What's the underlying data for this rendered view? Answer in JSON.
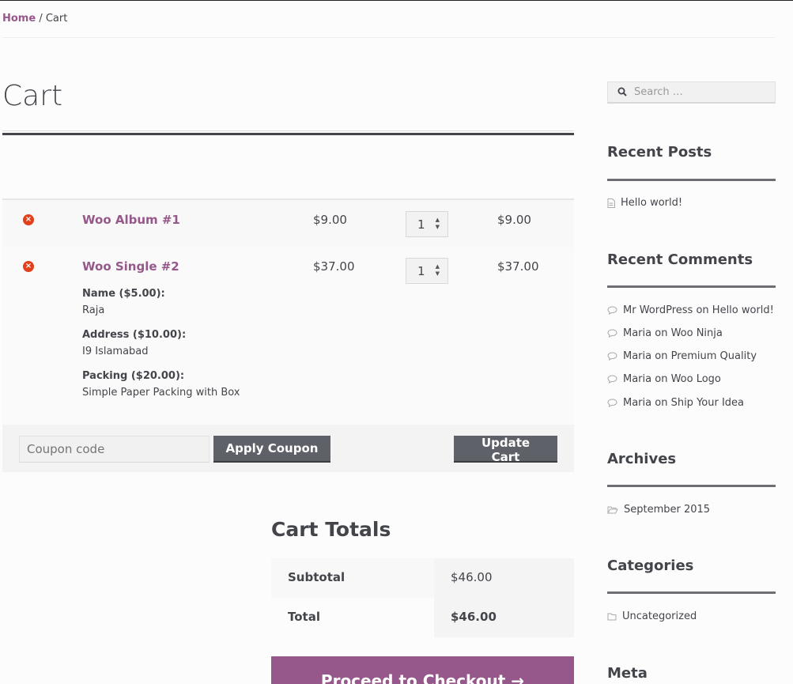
{
  "breadcrumb": {
    "home": "Home",
    "separator": " / ",
    "current": "Cart"
  },
  "page": {
    "title": "Cart"
  },
  "cart": {
    "items": [
      {
        "name": "Woo Album #1",
        "price": "$9.00",
        "qty": "1",
        "subtotal": "$9.00",
        "meta": []
      },
      {
        "name": "Woo Single #2",
        "price": "$37.00",
        "qty": "1",
        "subtotal": "$37.00",
        "meta": [
          {
            "label": "Name ($5.00):",
            "value": "Raja"
          },
          {
            "label": "Address ($10.00):",
            "value": "I9 Islamabad"
          },
          {
            "label": "Packing ($20.00):",
            "value": "Simple Paper Packing with Box"
          }
        ]
      }
    ],
    "remove_glyph": "×",
    "coupon_placeholder": "Coupon code",
    "apply_coupon": "Apply Coupon",
    "update_cart": "Update Cart"
  },
  "totals": {
    "title": "Cart Totals",
    "subtotal_label": "Subtotal",
    "subtotal_value": "$46.00",
    "total_label": "Total",
    "total_value": "$46.00",
    "checkout": "Proceed to Checkout →"
  },
  "sidebar": {
    "search_placeholder": "Search …",
    "recent_posts": {
      "title": "Recent Posts",
      "items": [
        "Hello world!"
      ]
    },
    "recent_comments": {
      "title": "Recent Comments",
      "items": [
        {
          "author": "Mr WordPress",
          "on": " on ",
          "post": "Hello world!"
        },
        {
          "author": "Maria",
          "on": " on ",
          "post": "Woo Ninja"
        },
        {
          "author": "Maria",
          "on": " on ",
          "post": "Premium Quality"
        },
        {
          "author": "Maria",
          "on": " on ",
          "post": "Woo Logo"
        },
        {
          "author": "Maria",
          "on": " on ",
          "post": "Ship Your Idea"
        }
      ]
    },
    "archives": {
      "title": "Archives",
      "items": [
        "September 2015"
      ]
    },
    "categories": {
      "title": "Categories",
      "items": [
        "Uncategorized"
      ]
    },
    "meta": {
      "title": "Meta"
    }
  },
  "colors": {
    "accent": "#96588a",
    "dark_button": "#5f6169",
    "remove": "#e2401c",
    "text": "#43454b"
  }
}
